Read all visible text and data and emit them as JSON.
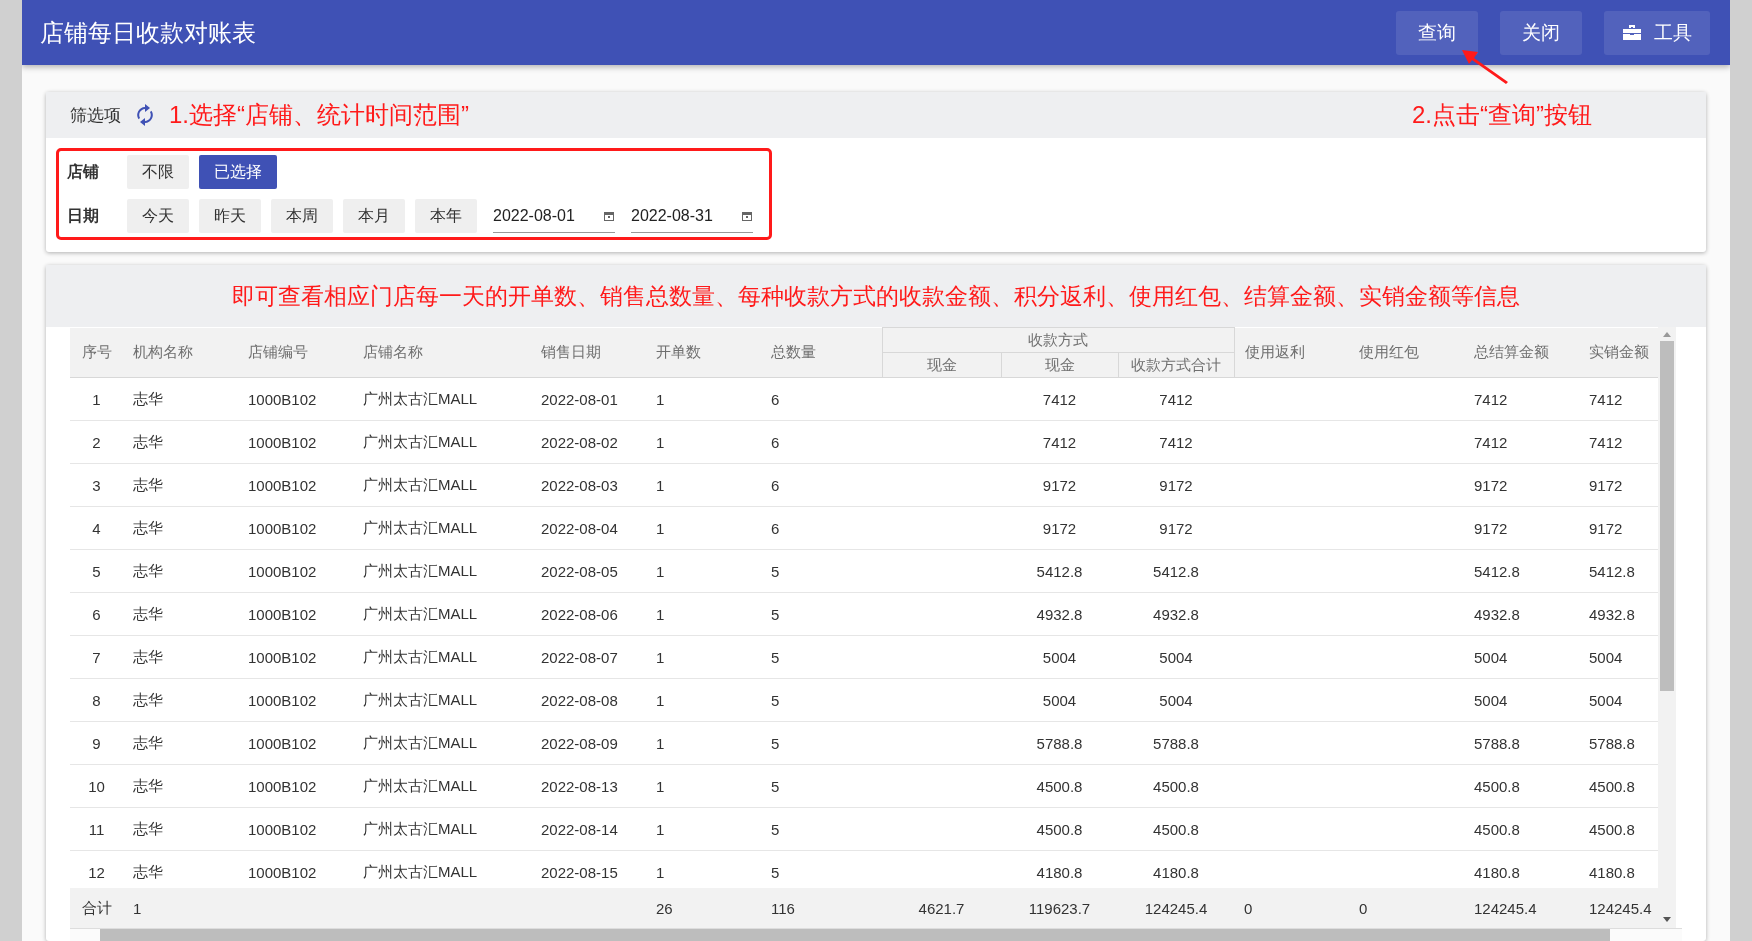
{
  "header": {
    "title": "店铺每日收款对账表",
    "buttons": [
      {
        "label": "查询",
        "kind": "plain"
      },
      {
        "label": "关闭",
        "kind": "plain"
      },
      {
        "label": "工具",
        "kind": "tool"
      }
    ]
  },
  "annotations": {
    "step1": "1.选择“店铺、统计时间范围”",
    "step2": "2.点击“查询”按钮",
    "summary": "即可查看相应门店每一天的开单数、销售总数量、每种收款方式的收款金额、积分返利、使用红包、结算金额、实销金额等信息"
  },
  "filter": {
    "title": "筛选项",
    "store": {
      "label": "店铺",
      "options": [
        {
          "label": "不限",
          "selected": false
        },
        {
          "label": "已选择",
          "selected": true
        }
      ]
    },
    "date": {
      "label": "日期",
      "presets": [
        "今天",
        "昨天",
        "本周",
        "本月",
        "本年"
      ],
      "start": "2022-08-01",
      "end": "2022-08-31"
    }
  },
  "table": {
    "columns": [
      "序号",
      "机构名称",
      "店铺编号",
      "店铺名称",
      "销售日期",
      "开单数",
      "总数量",
      "现金",
      "现金",
      "收款方式合计",
      "使用返利",
      "使用红包",
      "总结算金额",
      "实销金额"
    ],
    "group": {
      "label": "收款方式"
    },
    "rows": [
      [
        "1",
        "志华",
        "1000B102",
        "广州太古汇MALL",
        "2022-08-01",
        "1",
        "6",
        "",
        "7412",
        "7412",
        "",
        "",
        "7412",
        "7412"
      ],
      [
        "2",
        "志华",
        "1000B102",
        "广州太古汇MALL",
        "2022-08-02",
        "1",
        "6",
        "",
        "7412",
        "7412",
        "",
        "",
        "7412",
        "7412"
      ],
      [
        "3",
        "志华",
        "1000B102",
        "广州太古汇MALL",
        "2022-08-03",
        "1",
        "6",
        "",
        "9172",
        "9172",
        "",
        "",
        "9172",
        "9172"
      ],
      [
        "4",
        "志华",
        "1000B102",
        "广州太古汇MALL",
        "2022-08-04",
        "1",
        "6",
        "",
        "9172",
        "9172",
        "",
        "",
        "9172",
        "9172"
      ],
      [
        "5",
        "志华",
        "1000B102",
        "广州太古汇MALL",
        "2022-08-05",
        "1",
        "5",
        "",
        "5412.8",
        "5412.8",
        "",
        "",
        "5412.8",
        "5412.8"
      ],
      [
        "6",
        "志华",
        "1000B102",
        "广州太古汇MALL",
        "2022-08-06",
        "1",
        "5",
        "",
        "4932.8",
        "4932.8",
        "",
        "",
        "4932.8",
        "4932.8"
      ],
      [
        "7",
        "志华",
        "1000B102",
        "广州太古汇MALL",
        "2022-08-07",
        "1",
        "5",
        "",
        "5004",
        "5004",
        "",
        "",
        "5004",
        "5004"
      ],
      [
        "8",
        "志华",
        "1000B102",
        "广州太古汇MALL",
        "2022-08-08",
        "1",
        "5",
        "",
        "5004",
        "5004",
        "",
        "",
        "5004",
        "5004"
      ],
      [
        "9",
        "志华",
        "1000B102",
        "广州太古汇MALL",
        "2022-08-09",
        "1",
        "5",
        "",
        "5788.8",
        "5788.8",
        "",
        "",
        "5788.8",
        "5788.8"
      ],
      [
        "10",
        "志华",
        "1000B102",
        "广州太古汇MALL",
        "2022-08-13",
        "1",
        "5",
        "",
        "4500.8",
        "4500.8",
        "",
        "",
        "4500.8",
        "4500.8"
      ],
      [
        "11",
        "志华",
        "1000B102",
        "广州太古汇MALL",
        "2022-08-14",
        "1",
        "5",
        "",
        "4500.8",
        "4500.8",
        "",
        "",
        "4500.8",
        "4500.8"
      ],
      [
        "12",
        "志华",
        "1000B102",
        "广州太古汇MALL",
        "2022-08-15",
        "1",
        "5",
        "",
        "4180.8",
        "4180.8",
        "",
        "",
        "4180.8",
        "4180.8"
      ]
    ],
    "totals": {
      "label": "合计",
      "row_count": "1",
      "order_count": "26",
      "quantity": "116",
      "cash_1": "4621.7",
      "cash_2": "119623.7",
      "payment_total": "124245.4",
      "rebate": "0",
      "red_packet": "0",
      "settlement_total": "124245.4",
      "net_sales": "124245.4"
    }
  }
}
